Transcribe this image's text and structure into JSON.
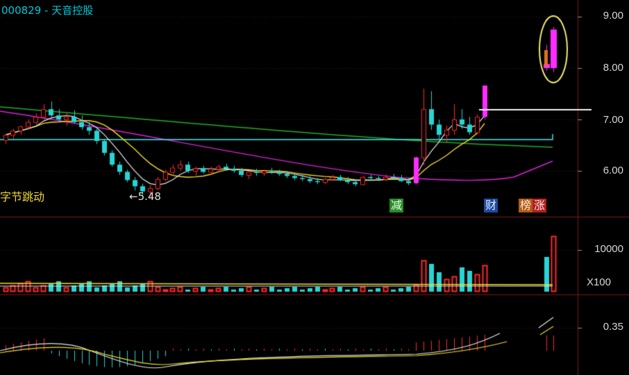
{
  "header": {
    "code": "000829",
    "separator": " - ",
    "name": "天音控股"
  },
  "price_axis": [
    {
      "value": 9.0,
      "label": "9.00"
    },
    {
      "value": 8.0,
      "label": "8.00"
    },
    {
      "value": 7.0,
      "label": "7.00"
    },
    {
      "value": 6.0,
      "label": "6.00"
    }
  ],
  "volume_axis": {
    "label": "10000",
    "multiplier": "X100"
  },
  "macd_axis": {
    "label": "0.35"
  },
  "annotations": {
    "left_label": "字节跳动",
    "low_marker": "5.48"
  },
  "event_tags": [
    {
      "text": "减",
      "bg": "#2a8a2a"
    },
    {
      "text": "财",
      "bg": "#1e4aa0"
    },
    {
      "text": "榜",
      "bg": "#b05a1a"
    },
    {
      "text": "涨",
      "bg": "#b02020"
    }
  ],
  "colors": {
    "up": "#ff2a2a",
    "down": "#28d4d4",
    "limit_up": "#ff2cff",
    "ma_white": "#e8e8e8",
    "ma_yellow": "#f0e020",
    "ma_magenta": "#e020e0",
    "ma_green": "#20b020",
    "ma_cyan": "#40f0f0",
    "grid": "#7a1a1a",
    "highlight_ring": "#f2ea70"
  },
  "chart_data": {
    "type": "candlestick",
    "symbol": "000829",
    "price_range": [
      5.3,
      9.3
    ],
    "candles": [
      [
        6.6,
        6.72,
        6.52,
        6.7
      ],
      [
        6.7,
        6.82,
        6.62,
        6.78
      ],
      [
        6.78,
        6.88,
        6.7,
        6.86
      ],
      [
        6.86,
        7.0,
        6.8,
        6.95
      ],
      [
        6.95,
        7.12,
        6.9,
        7.05
      ],
      [
        7.05,
        7.3,
        7.0,
        7.2
      ],
      [
        7.2,
        7.35,
        7.02,
        7.08
      ],
      [
        7.08,
        7.2,
        6.95,
        7.0
      ],
      [
        7.0,
        7.12,
        6.88,
        7.05
      ],
      [
        7.05,
        7.18,
        6.92,
        6.95
      ],
      [
        6.95,
        7.08,
        6.8,
        6.85
      ],
      [
        6.85,
        6.95,
        6.7,
        6.78
      ],
      [
        6.78,
        6.82,
        6.52,
        6.58
      ],
      [
        6.58,
        6.62,
        6.3,
        6.35
      ],
      [
        6.35,
        6.4,
        6.08,
        6.12
      ],
      [
        6.12,
        6.18,
        5.92,
        5.98
      ],
      [
        5.98,
        6.02,
        5.78,
        5.82
      ],
      [
        5.82,
        5.88,
        5.62,
        5.7
      ],
      [
        5.7,
        5.75,
        5.52,
        5.6
      ],
      [
        5.6,
        5.72,
        5.48,
        5.66
      ],
      [
        5.66,
        5.88,
        5.62,
        5.84
      ],
      [
        5.84,
        6.02,
        5.8,
        5.98
      ],
      [
        5.98,
        6.12,
        5.92,
        6.06
      ],
      [
        6.06,
        6.2,
        6.0,
        6.12
      ],
      [
        6.12,
        6.18,
        5.96,
        6.0
      ],
      [
        6.0,
        6.08,
        5.9,
        6.05
      ],
      [
        6.05,
        6.1,
        5.95,
        5.98
      ],
      [
        5.98,
        6.08,
        5.92,
        6.04
      ],
      [
        6.04,
        6.12,
        5.98,
        6.08
      ],
      [
        6.08,
        6.14,
        6.0,
        6.04
      ],
      [
        6.04,
        6.1,
        5.96,
        6.0
      ],
      [
        6.0,
        6.06,
        5.88,
        5.92
      ],
      [
        5.92,
        6.0,
        5.84,
        5.98
      ],
      [
        5.98,
        6.04,
        5.9,
        5.96
      ],
      [
        5.96,
        6.02,
        5.9,
        6.0
      ],
      [
        6.0,
        6.06,
        5.94,
        5.98
      ],
      [
        5.98,
        6.02,
        5.9,
        5.94
      ],
      [
        5.94,
        6.0,
        5.86,
        5.9
      ],
      [
        5.9,
        5.96,
        5.82,
        5.86
      ],
      [
        5.86,
        5.92,
        5.8,
        5.84
      ],
      [
        5.84,
        5.9,
        5.76,
        5.8
      ],
      [
        5.8,
        5.86,
        5.74,
        5.78
      ],
      [
        5.78,
        5.86,
        5.74,
        5.84
      ],
      [
        5.84,
        5.92,
        5.8,
        5.88
      ],
      [
        5.88,
        5.92,
        5.8,
        5.82
      ],
      [
        5.82,
        5.88,
        5.74,
        5.78
      ],
      [
        5.78,
        5.84,
        5.7,
        5.74
      ],
      [
        5.74,
        5.9,
        5.72,
        5.88
      ],
      [
        5.88,
        5.92,
        5.82,
        5.86
      ],
      [
        5.86,
        5.9,
        5.8,
        5.84
      ],
      [
        5.84,
        5.92,
        5.8,
        5.88
      ],
      [
        5.88,
        5.94,
        5.82,
        5.86
      ],
      [
        5.86,
        5.92,
        5.78,
        5.8
      ],
      [
        5.8,
        5.86,
        5.72,
        5.76
      ],
      [
        5.76,
        6.28,
        5.74,
        6.26
      ],
      [
        6.26,
        7.6,
        6.1,
        7.2
      ],
      [
        7.2,
        7.55,
        6.8,
        6.9
      ],
      [
        6.9,
        7.0,
        6.62,
        6.7
      ],
      [
        6.7,
        6.88,
        6.55,
        6.8
      ],
      [
        6.8,
        7.3,
        6.7,
        7.0
      ],
      [
        7.0,
        7.2,
        6.82,
        6.9
      ],
      [
        6.9,
        7.05,
        6.7,
        6.75
      ],
      [
        6.75,
        7.1,
        6.7,
        7.05
      ],
      [
        7.05,
        7.66,
        7.0,
        7.66
      ],
      [
        8.08,
        8.45,
        7.95,
        8.0
      ],
      [
        8.0,
        8.8,
        7.92,
        8.75
      ]
    ],
    "volume_scale": "X100",
    "volume_tick": 10000,
    "macd_tick": 0.35
  }
}
